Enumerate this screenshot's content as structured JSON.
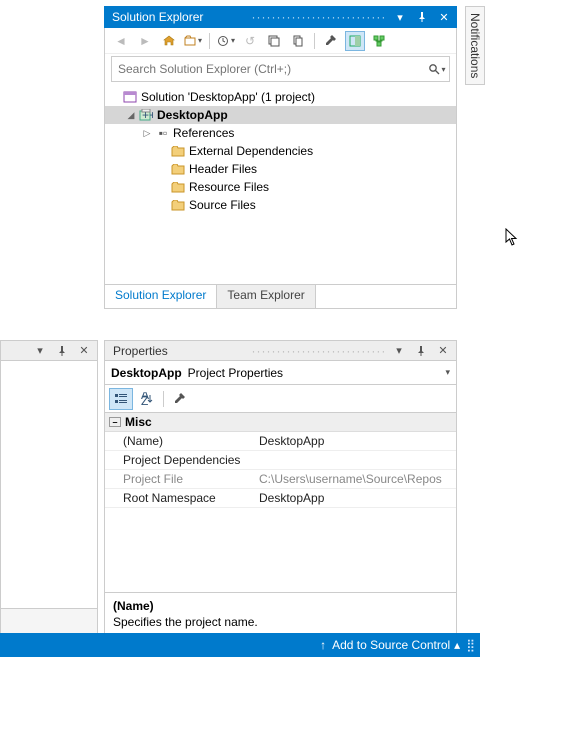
{
  "notifications_tab": "Notifications",
  "solution_explorer": {
    "title": "Solution Explorer",
    "search_placeholder": "Search Solution Explorer (Ctrl+;)",
    "solution_label": "Solution 'DesktopApp' (1 project)",
    "project": "DesktopApp",
    "nodes": {
      "references": "References",
      "ext_deps": "External Dependencies",
      "header_files": "Header Files",
      "resource_files": "Resource Files",
      "source_files": "Source Files"
    },
    "tabs": {
      "solution": "Solution Explorer",
      "team": "Team Explorer"
    }
  },
  "properties": {
    "title": "Properties",
    "object_name": "DesktopApp",
    "object_type": "Project Properties",
    "category": "Misc",
    "rows": {
      "name_label": "(Name)",
      "name_value": "DesktopApp",
      "deps_label": "Project Dependencies",
      "deps_value": "",
      "file_label": "Project File",
      "file_value": "C:\\Users\\username\\Source\\Repos",
      "ns_label": "Root Namespace",
      "ns_value": "DesktopApp"
    },
    "desc_name": "(Name)",
    "desc_text": "Specifies the project name."
  },
  "statusbar": {
    "add_source": "Add to Source Control"
  }
}
